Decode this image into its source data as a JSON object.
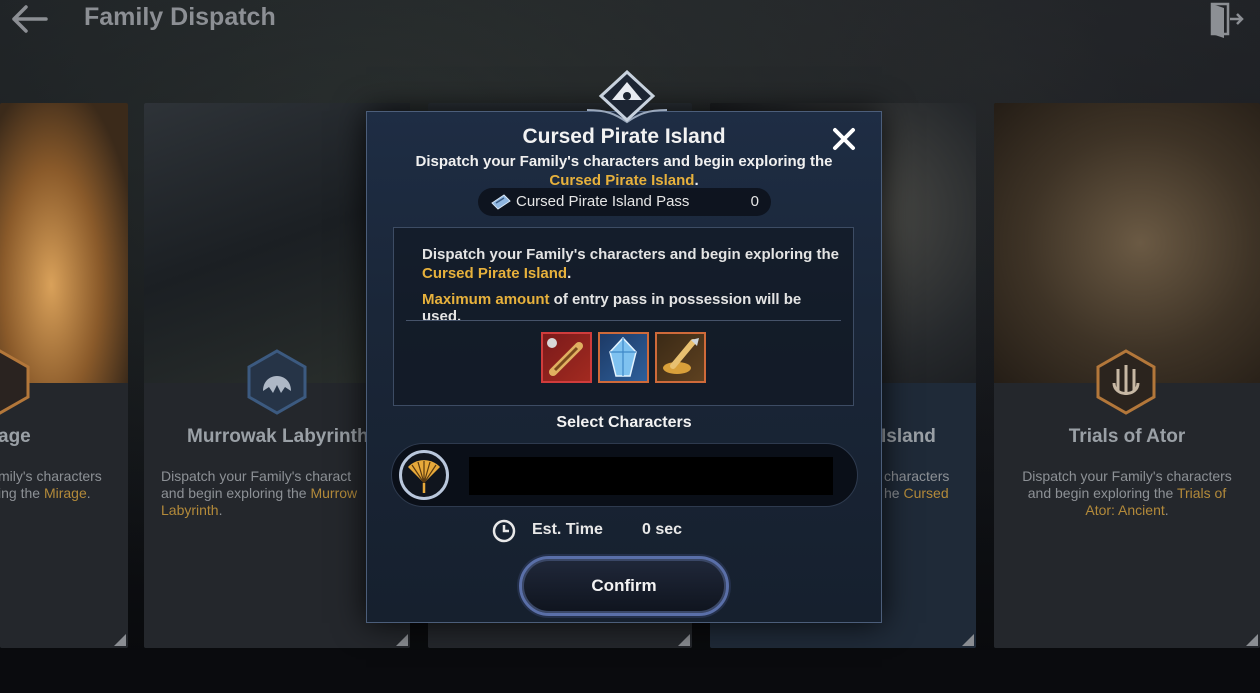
{
  "header": {
    "title": "Family Dispatch"
  },
  "cards": [
    {
      "name": "age",
      "desc_pre": "mily's characters\ning the ",
      "desc_hl": "Mirage",
      "desc_post": "."
    },
    {
      "name": "Murrowak Labyrinth",
      "desc_pre": "Dispatch your Family's charact\nand begin exploring the ",
      "desc_hl": "Murrow\nLabyrinth",
      "desc_post": "."
    },
    {
      "name": "Island",
      "desc_pre": "characters\nhe ",
      "desc_hl": "Cursed",
      "desc_post": ""
    },
    {
      "name": "Trials of Ator",
      "desc_pre": "Dispatch your Family's characters\nand begin exploring the ",
      "desc_hl": "Trials of\nAtor: Ancient",
      "desc_post": "."
    }
  ],
  "modal": {
    "title": "Cursed Pirate Island",
    "subtitle_pre": "Dispatch your Family's characters and begin exploring the",
    "subtitle_hl": "Cursed Pirate Island",
    "subtitle_post": ".",
    "pass_label": "Cursed Pirate Island Pass",
    "pass_count": "0",
    "info_line1_pre": "Dispatch your Family's characters and begin exploring the",
    "info_line1_hl": "Cursed Pirate Island",
    "info_line1_post": ".",
    "info_line2_hl": "Maximum amount",
    "info_line2_rest": " of entry pass in possession will be used.",
    "items": [
      "spyglass-item",
      "blue-crystal-item",
      "golden-drill-item"
    ],
    "select_label": "Select Characters",
    "est_label": "Est. Time",
    "est_value": "0 sec",
    "confirm_label": "Confirm"
  },
  "colors": {
    "highlight_gold": "#e7b13c",
    "modal_border": "#4c5e7a",
    "confirm_ring": "#5a6fa8"
  }
}
